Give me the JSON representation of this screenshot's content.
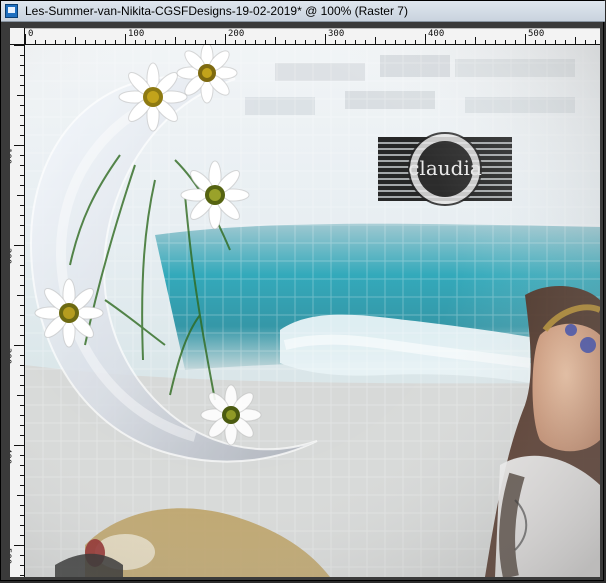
{
  "window": {
    "title": "Les-Summer-van-Nikita-CGSFDesigns-19-02-2019* @ 100% (Raster 7)"
  },
  "ruler": {
    "top_labels": [
      "0",
      "100",
      "200",
      "300",
      "400",
      "500"
    ],
    "left_labels": [
      "100",
      "200",
      "300",
      "400",
      "500"
    ]
  },
  "canvas": {
    "watermark_text": "claudia"
  },
  "colors": {
    "titlebar": "#d3dce6",
    "ruler": "#f3f3f3",
    "frame_dark": "#2b2b2b",
    "sea": "#2aa6b8",
    "sky": "#e9eef2"
  }
}
